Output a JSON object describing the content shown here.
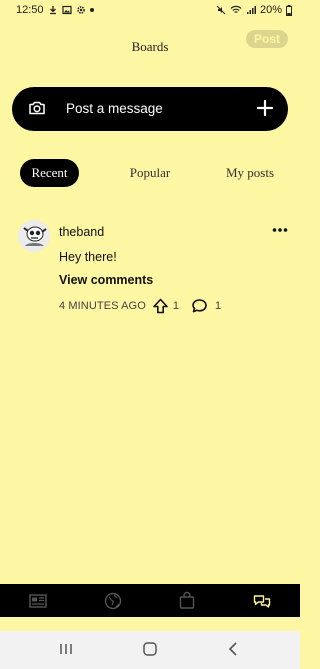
{
  "status_bar": {
    "time": "12:50",
    "battery": "20%"
  },
  "header": {
    "title": "Boards",
    "post_button": "Post"
  },
  "composer": {
    "label": "Post a message"
  },
  "tabs": [
    {
      "label": "Recent",
      "active": true
    },
    {
      "label": "Popular",
      "active": false
    },
    {
      "label": "My posts",
      "active": false
    }
  ],
  "post": {
    "username": "theband",
    "text": "Hey there!",
    "view_comments": "View comments",
    "time_ago": "4 MINUTES AGO",
    "upvotes": "1",
    "comments": "1"
  },
  "bottom_nav": [
    {
      "name": "news-icon"
    },
    {
      "name": "globe-icon"
    },
    {
      "name": "shopping-bag-icon"
    },
    {
      "name": "chat-icon",
      "active": true
    }
  ],
  "colors": {
    "background": "#fdf6a3",
    "dark": "#000000",
    "post_button_bg": "#dcd58f"
  }
}
